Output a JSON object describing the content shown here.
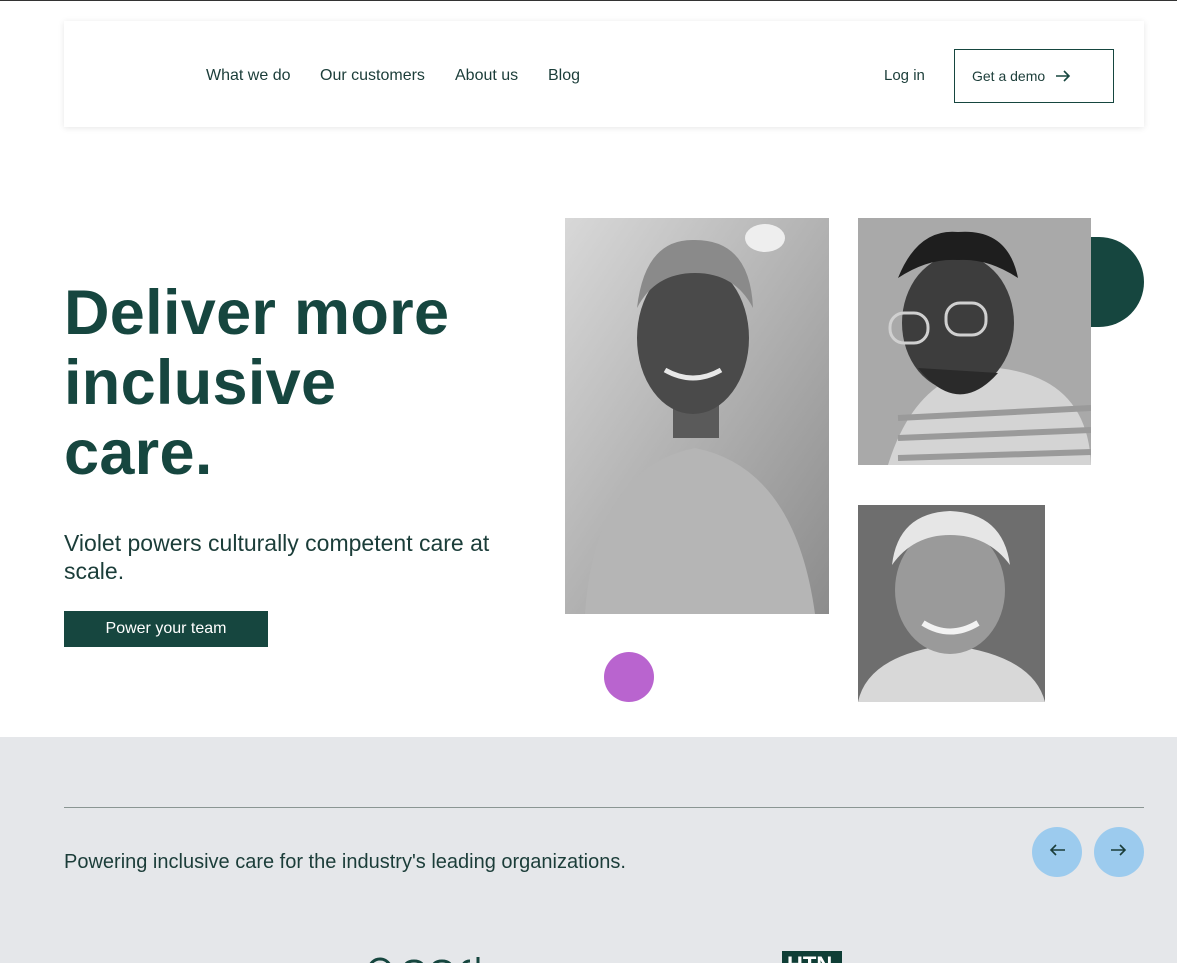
{
  "nav": {
    "links": [
      "What we do",
      "Our customers",
      "About us",
      "Blog"
    ],
    "login": "Log in",
    "demo": "Get a demo"
  },
  "hero": {
    "title_line1": "Deliver more",
    "title_line2": "inclusive",
    "title_line3": "care.",
    "subtitle": "Violet powers culturally competent care at scale.",
    "cta": "Power your team"
  },
  "band": {
    "text": "Powering inclusive care for the industry's leading organizations.",
    "logo_b_text": "HTN"
  },
  "colors": {
    "brand": "#16463f",
    "accent_purple": "#b964cf",
    "band_bg": "#e5e7ea",
    "circle_btn": "#9ccbee"
  },
  "icons": [
    "arrow-right-icon",
    "arrow-left-icon"
  ]
}
